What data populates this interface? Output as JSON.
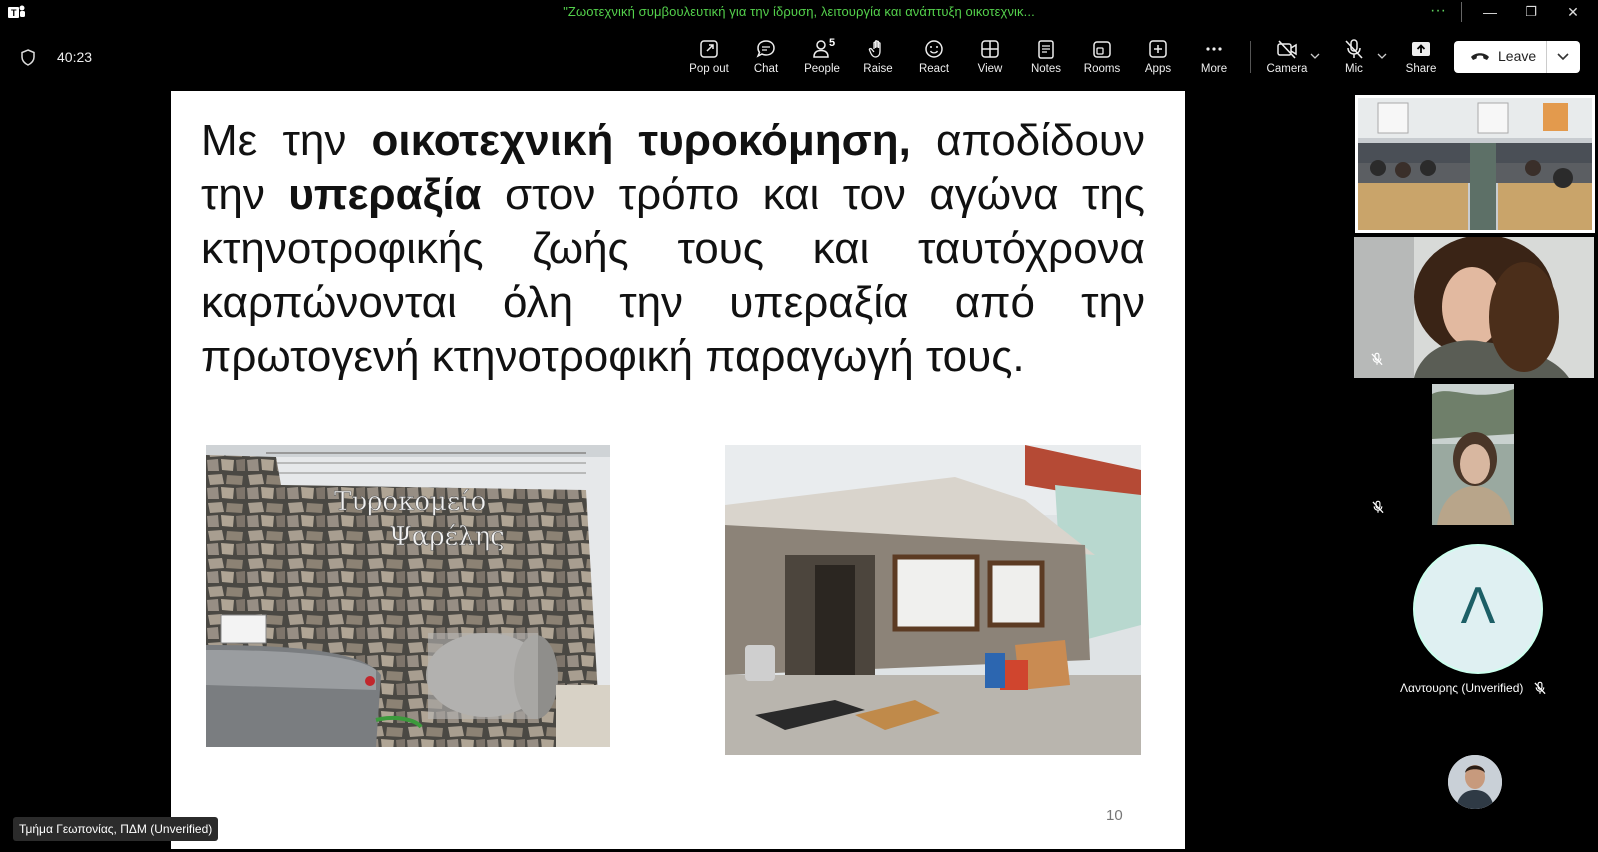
{
  "window": {
    "title": "\"Ζωοτεχνική συμβουλευτική για την ίδρυση, λειτουργία και ανάπτυξη οικοτεχνικ...",
    "more_glyph": "···",
    "minimize_glyph": "—",
    "restore_glyph": "❐",
    "close_glyph": "✕"
  },
  "meeting": {
    "timer": "40:23",
    "toolbar": {
      "popout": "Pop out",
      "chat": "Chat",
      "people": "People",
      "people_count": "5",
      "raise": "Raise",
      "react": "React",
      "view": "View",
      "notes": "Notes",
      "rooms": "Rooms",
      "apps": "Apps",
      "more": "More",
      "camera": "Camera",
      "mic": "Mic",
      "share": "Share",
      "leave": "Leave"
    }
  },
  "slide": {
    "line1_pre": "Με την ",
    "line1_bold": "οικοτεχνική τυροκόμηση,",
    "line1_post": " αποδίδουν την ",
    "line2_bold": "υπεραξία",
    "rest": " στον τρόπο και τον αγώνα της κτηνοτροφικής ζωής τους και ταυτόχρονα καρπώνονται όλη την υπεραξία από την πρωτογενή κτηνοτροφική παραγωγή τους.",
    "sign_text_1": "Τυροκομείο",
    "sign_text_2": "Ψαρέλης",
    "page_number": "10"
  },
  "participants": {
    "avatar_initial": "Λ",
    "avatar_name": "Λαντουρης (Unverified)",
    "presenter": "Τμήμα Γεωπονίας, ΠΔΜ (Unverified)"
  }
}
